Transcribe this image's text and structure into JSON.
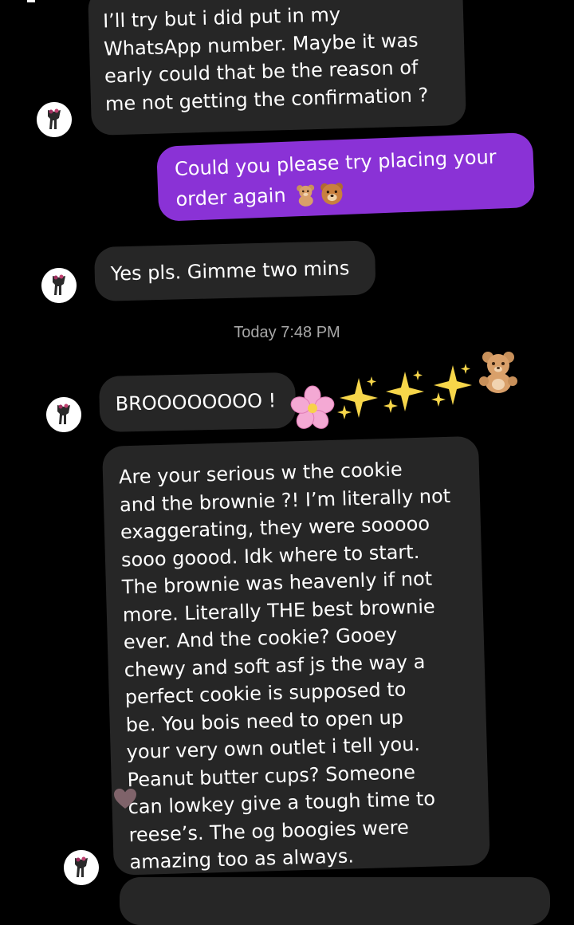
{
  "messages": [
    {
      "id": "m1",
      "direction": "incoming",
      "lines": [
        "I’ll try but i did put in my",
        "WhatsApp number.  Maybe it was",
        "early could that be the reason of",
        "me not getting the confirmation ?"
      ]
    },
    {
      "id": "m2",
      "direction": "outgoing",
      "lines": [
        "Could you please try placing your",
        "order again"
      ],
      "emojis": [
        "teddy-bear",
        "bear-face"
      ]
    },
    {
      "id": "m3",
      "direction": "incoming",
      "lines": [
        "Yes pls. Gimme two mins"
      ]
    },
    {
      "id": "m4",
      "direction": "incoming",
      "lines": [
        "BROOOOOOOO !"
      ],
      "emojis": [
        "cherry-blossom",
        "sparkles",
        "sparkles",
        "sparkles",
        "teddy-bear"
      ]
    },
    {
      "id": "m5",
      "direction": "incoming",
      "lines": [
        "Are your serious w the cookie",
        "and the brownie ?! I’m literally not",
        "exaggerating, they were sooooo",
        "sooo goood. Idk where to start.",
        "The brownie was heavenly if not",
        "more. Literally THE best brownie",
        "ever. And the cookie? Gooey",
        "chewy and soft asf js the way a",
        "perfect cookie is supposed to",
        "be. You bois need to open up",
        "your very own outlet i tell you.",
        "Peanut butter cups? Someone",
        "can lowkey give a tough time to",
        "reese’s. The og boogies were",
        "amazing too as always."
      ],
      "reaction": "heart"
    }
  ],
  "timestamp": "Today 7:48 PM",
  "colors": {
    "background": "#000000",
    "incoming_bubble": "#262626",
    "outgoing_bubble": "#8a32d6",
    "timestamp": "#a8a8a8",
    "text": "#ffffff"
  },
  "icons": {
    "avatar": "profile-avatar-icon",
    "reaction": "heart-reaction-icon"
  }
}
